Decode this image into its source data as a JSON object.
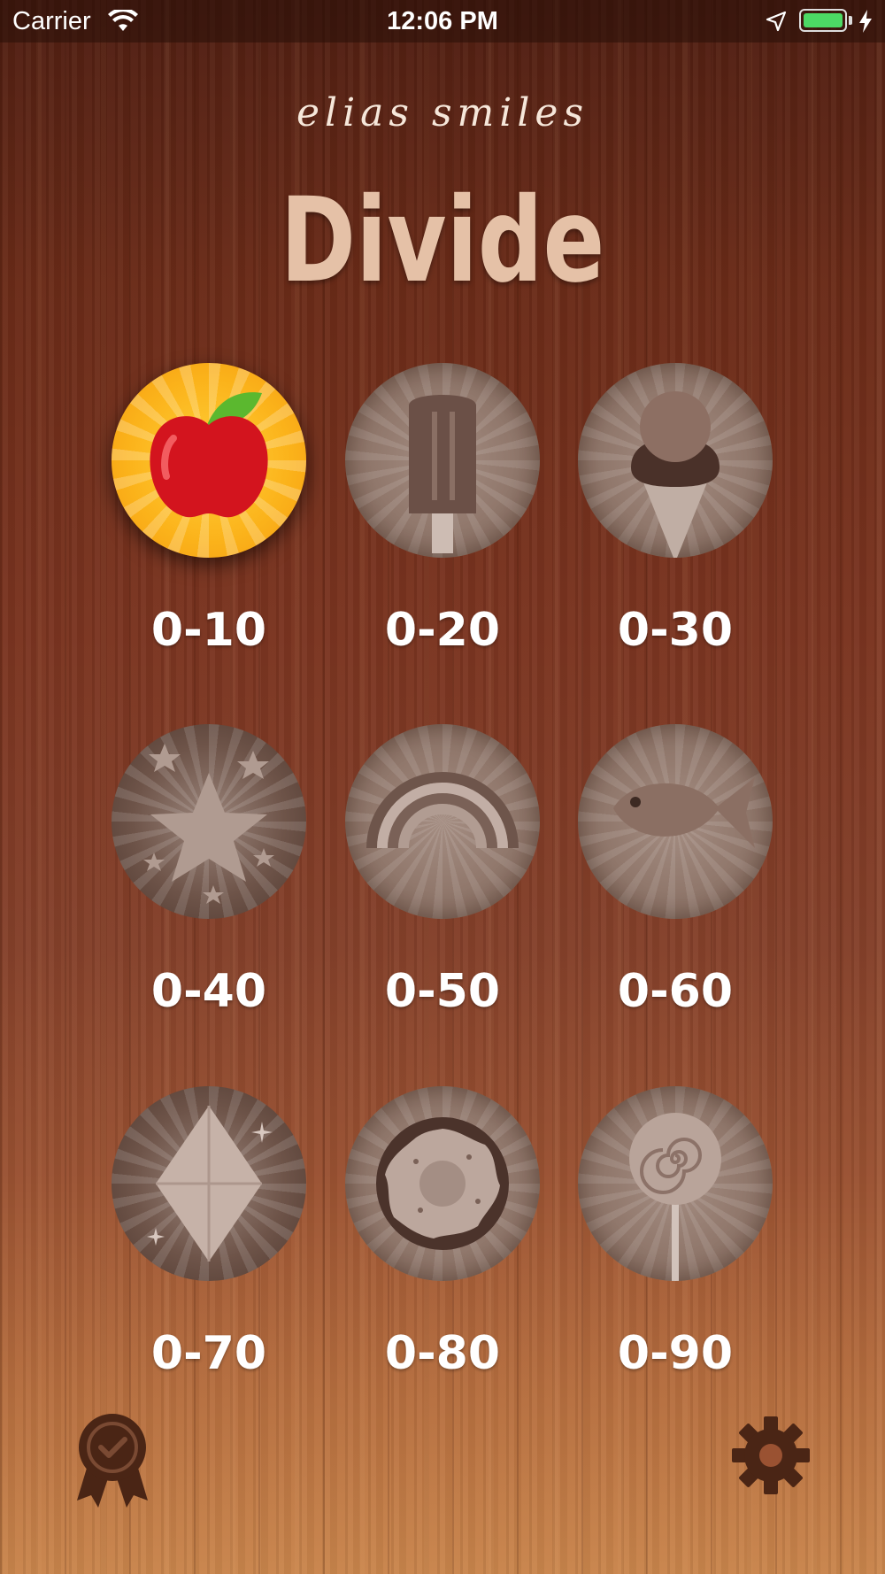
{
  "status_bar": {
    "carrier": "Carrier",
    "time": "12:06 PM",
    "icons": [
      "wifi-icon",
      "location-arrow-icon",
      "battery-icon",
      "charging-bolt-icon"
    ],
    "battery_color": "#4cd964"
  },
  "header": {
    "brand": "elias smiles",
    "title": "Divide"
  },
  "levels": [
    {
      "label": "0-10",
      "icon": "apple-icon",
      "locked": false
    },
    {
      "label": "0-20",
      "icon": "popsicle-icon",
      "locked": true
    },
    {
      "label": "0-30",
      "icon": "ice-cream-cone-icon",
      "locked": true
    },
    {
      "label": "0-40",
      "icon": "star-icon",
      "locked": true
    },
    {
      "label": "0-50",
      "icon": "rainbow-icon",
      "locked": true
    },
    {
      "label": "0-60",
      "icon": "fish-icon",
      "locked": true
    },
    {
      "label": "0-70",
      "icon": "diamond-icon",
      "locked": true
    },
    {
      "label": "0-80",
      "icon": "donut-icon",
      "locked": true
    },
    {
      "label": "0-90",
      "icon": "lollipop-icon",
      "locked": true
    }
  ],
  "footer": {
    "left_icon": "award-ribbon-icon",
    "right_icon": "gear-icon"
  },
  "colors": {
    "title": "#e5c1a7",
    "unlocked_badge": "#fbb21a",
    "locked_badge": "#8f766a",
    "icon_buttons": "#4a2515"
  }
}
